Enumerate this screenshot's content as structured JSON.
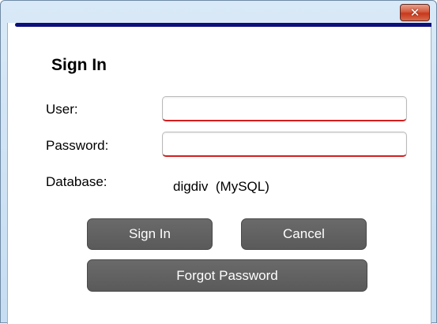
{
  "window": {
    "close_glyph": "✕"
  },
  "form": {
    "heading": "Sign In",
    "user_label": "User:",
    "user_value": "",
    "password_label": "Password:",
    "password_value": "",
    "database_label": "Database:",
    "database_name": "digdiv",
    "database_type": "(MySQL)"
  },
  "buttons": {
    "sign_in": "Sign In",
    "cancel": "Cancel",
    "forgot_password": "Forgot Password"
  },
  "colors": {
    "accent_bar": "#0d0f7a",
    "field_underline": "#d41e1e",
    "button_bg": "#5f5f5f",
    "close_button": "#c7381b"
  }
}
